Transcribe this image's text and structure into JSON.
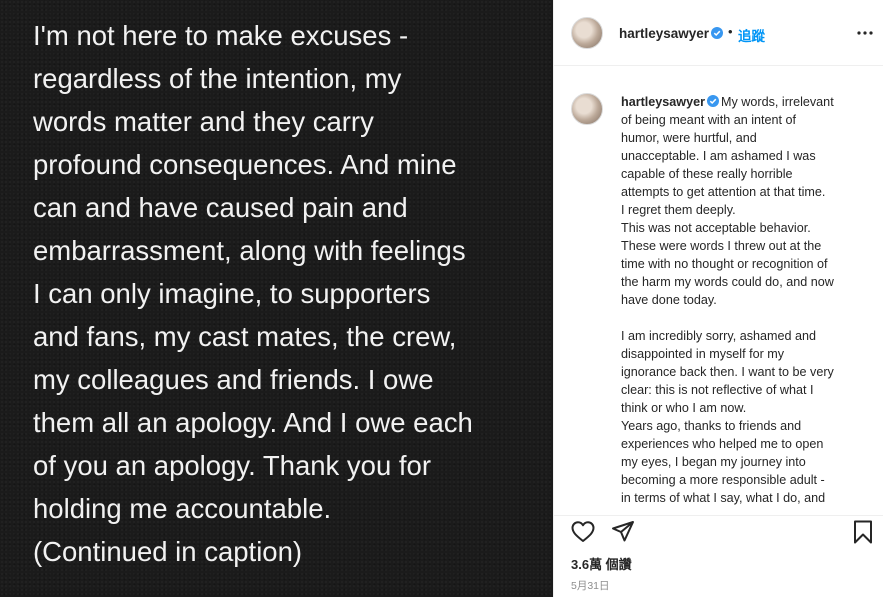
{
  "post": {
    "image_text": "I'm not here to make excuses -\nregardless of the intention, my\nwords matter and they carry\nprofound consequences. And mine\ncan and have caused pain and\nembarrassment, along with feelings\nI can only imagine, to supporters\nand fans, my cast mates, the crew,\nmy colleagues and friends. I owe\nthem all an apology. And I owe each\nof you an apology. Thank you for\nholding me accountable.\n(Continued in caption)"
  },
  "header": {
    "username": "hartleysawyer",
    "separator": "•",
    "follow_label": "追蹤"
  },
  "caption": {
    "username": "hartleysawyer",
    "text": "My words, irrelevant\nof being meant with an intent of\nhumor, were hurtful, and\nunacceptable. I am ashamed I was\ncapable of these really horrible\nattempts to get attention at that time.\nI regret them deeply.\nThis was not acceptable behavior.\nThese were words I threw out at the\ntime with no thought or recognition of\nthe harm my words could do, and now\nhave done today.\n\nI am incredibly sorry, ashamed and\ndisappointed in myself for my\nignorance back then. I want to be very\nclear: this is not reflective of what I\nthink or who I am now.\nYears ago, thanks to friends and\nexperiences who helped me to open\nmy eyes, I began my journey into\nbecoming a more responsible adult -\nin terms of what I say, what I do, and"
  },
  "actions": {
    "views": "3.6萬 個讚",
    "date": "5月31日"
  },
  "colors": {
    "accent": "#0095f6",
    "verified": "#3897f0",
    "image_bg": "#1b1b1b",
    "muted": "#8e8e8e"
  },
  "icons": [
    "verified-badge-icon",
    "more-options-icon",
    "heart-icon",
    "share-icon",
    "bookmark-icon"
  ]
}
